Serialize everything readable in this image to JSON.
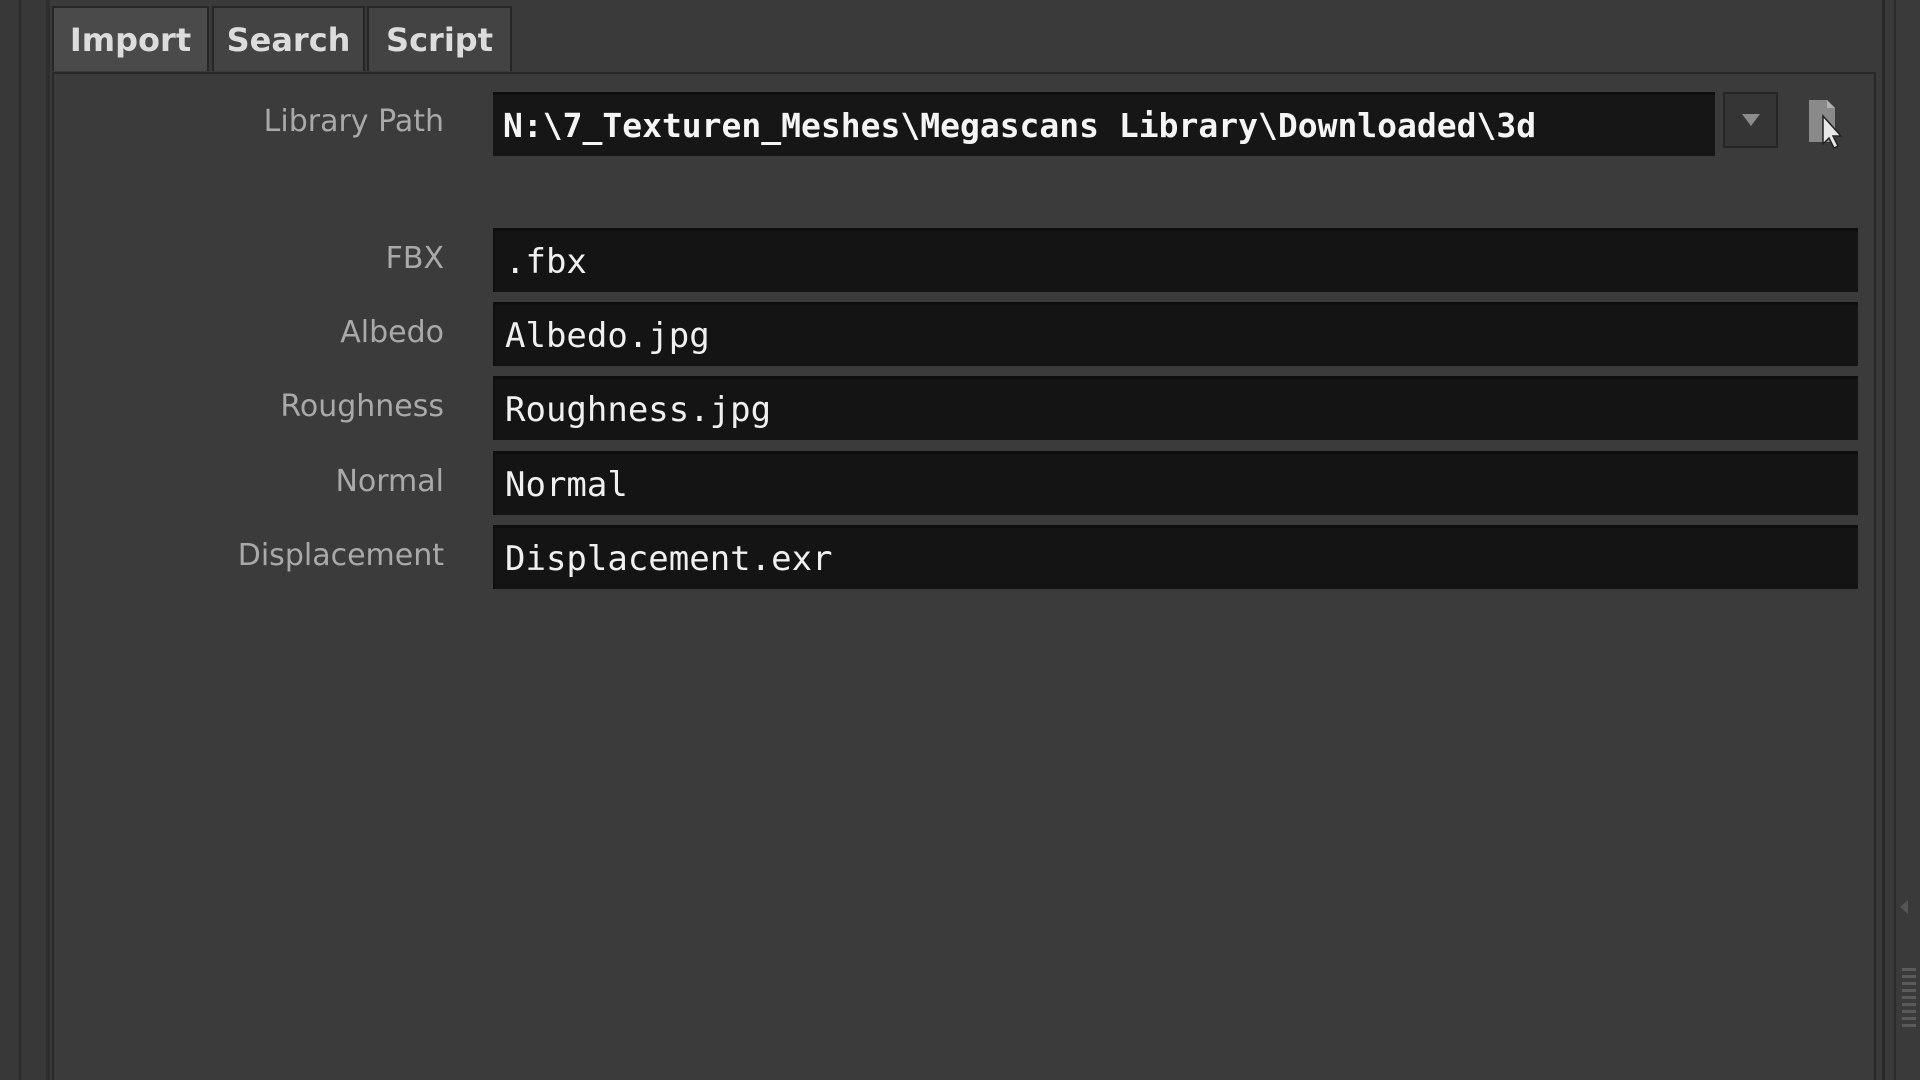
{
  "tabs": [
    {
      "label": "Import"
    },
    {
      "label": "Search"
    },
    {
      "label": "Script"
    }
  ],
  "library_path": {
    "label": "Library Path",
    "value": "N:\\7_Texturen_Meshes\\Megascans Library\\Downloaded\\3d"
  },
  "fields": {
    "fbx": {
      "label": "FBX",
      "value": ".fbx"
    },
    "albedo": {
      "label": "Albedo",
      "value": "Albedo.jpg"
    },
    "roughness": {
      "label": "Roughness",
      "value": "Roughness.jpg"
    },
    "normal": {
      "label": "Normal",
      "value": "Normal"
    },
    "displacement": {
      "label": "Displacement",
      "value": "Displacement.exr"
    }
  },
  "icons": {
    "dropdown": "chevron-down-icon",
    "file_chooser": "file-chooser-icon"
  },
  "colors": {
    "background": "#3a3a3a",
    "field_background": "#141414",
    "label_text": "#a9a9a9",
    "field_text": "#f0f0f0"
  }
}
